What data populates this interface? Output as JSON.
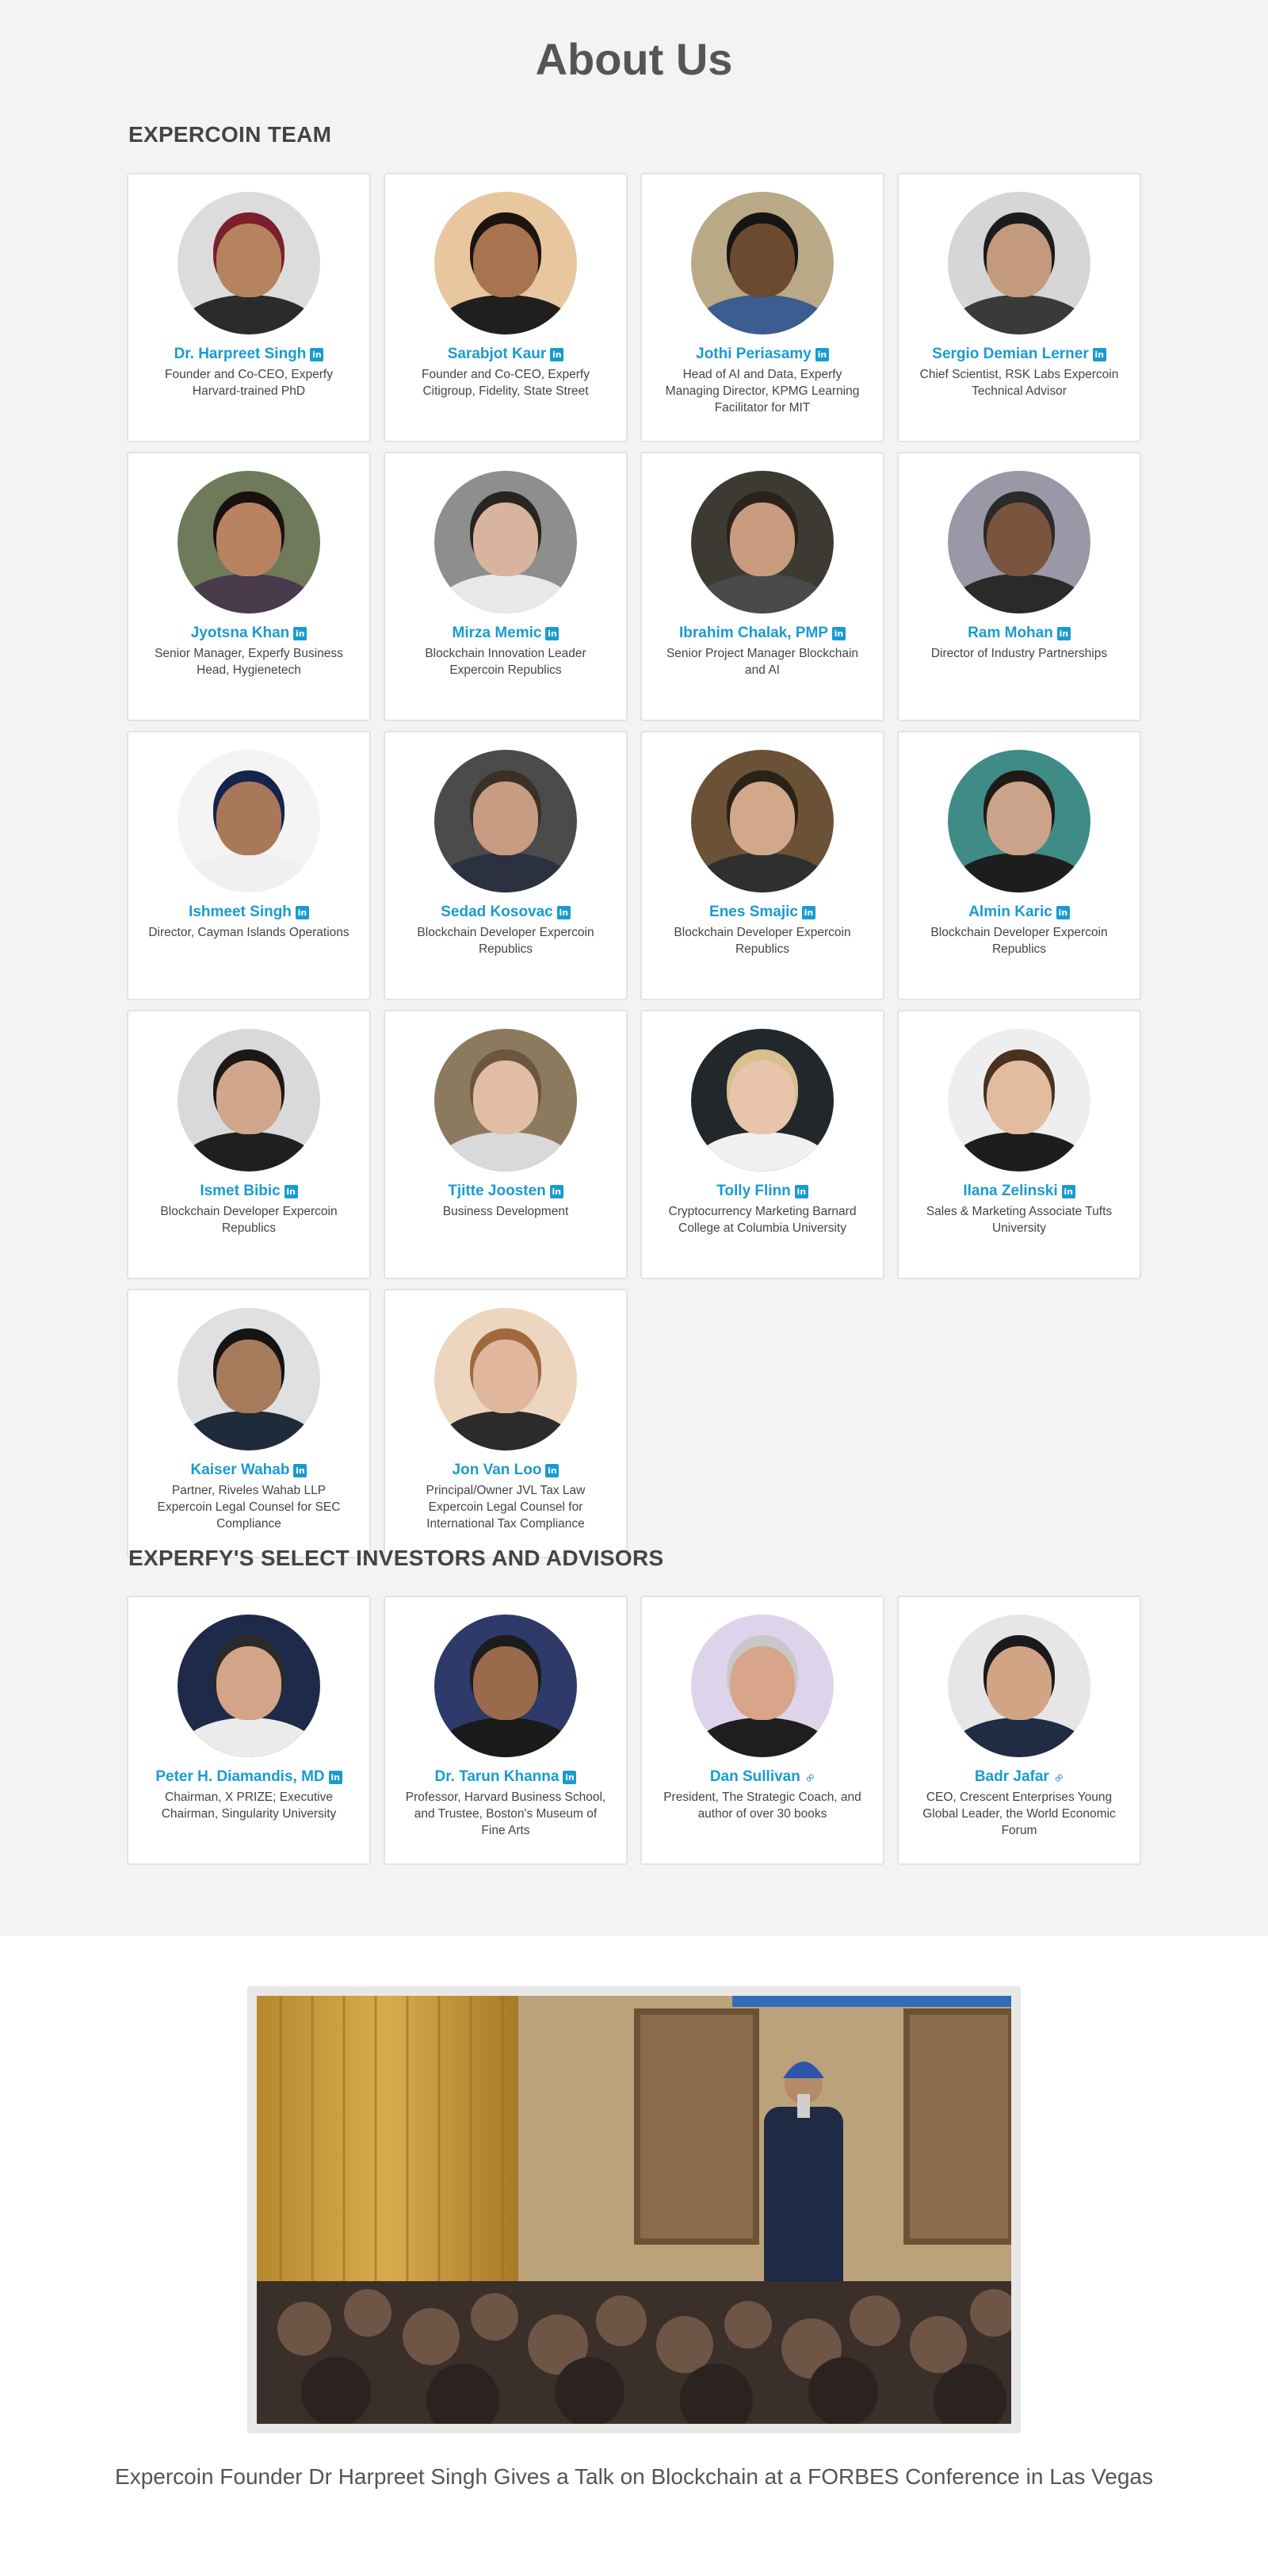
{
  "page": {
    "title": "About Us"
  },
  "team": {
    "heading": "EXPERCOIN TEAM",
    "members": [
      {
        "name": "Dr. Harpreet Singh",
        "role": "Founder and Co-CEO, Experfy Harvard-trained PhD",
        "link": "linkedin",
        "bg": "#dcdcdc",
        "skin": "#b5835e",
        "hair": "#7a1f2b",
        "shirt": "#2b2b2b"
      },
      {
        "name": "Sarabjot Kaur",
        "role": "Founder and Co-CEO, Experfy Citigroup, Fidelity, State Street",
        "link": "linkedin",
        "bg": "#e9c79e",
        "skin": "#a8744f",
        "hair": "#1d1410",
        "shirt": "#1f1f1f"
      },
      {
        "name": "Jothi Periasamy",
        "role": "Head of AI and Data, Experfy Managing Director, KPMG Learning Facilitator for MIT",
        "link": "linkedin",
        "bg": "#b9a987",
        "skin": "#6b4a30",
        "hair": "#151515",
        "shirt": "#3b5d8f"
      },
      {
        "name": "Sergio Demian Lerner",
        "role": "Chief Scientist, RSK Labs Expercoin Technical Advisor",
        "link": "linkedin",
        "bg": "#d6d6d6",
        "skin": "#c49a7e",
        "hair": "#1c1c1c",
        "shirt": "#3a3a3a"
      },
      {
        "name": "Jyotsna Khan",
        "role": "Senior Manager, Experfy Business Head, Hygienetech",
        "link": "linkedin",
        "bg": "#6f7a5a",
        "skin": "#b98361",
        "hair": "#18110d",
        "shirt": "#4a3b4c"
      },
      {
        "name": "Mirza Memic",
        "role": "Blockchain Innovation Leader Expercoin Republics",
        "link": "linkedin",
        "bg": "#8e8e8e",
        "skin": "#d8b49e",
        "hair": "#2a2420",
        "shirt": "#e8e8e8"
      },
      {
        "name": "Ibrahim Chalak, PMP",
        "role": "Senior Project Manager Blockchain and AI",
        "link": "linkedin",
        "bg": "#3d3a33",
        "skin": "#c99b7e",
        "hair": "#2c2219",
        "shirt": "#4a4a4a"
      },
      {
        "name": "Ram Mohan",
        "role": "Director of Industry Partnerships",
        "link": "linkedin",
        "bg": "#9a97a6",
        "skin": "#7a543d",
        "hair": "#2a2a2a",
        "shirt": "#2a2a2a"
      },
      {
        "name": "Ishmeet Singh",
        "role": "Director, Cayman Islands Operations",
        "link": "linkedin",
        "bg": "#f4f4f4",
        "skin": "#a9785a",
        "hair": "#15234e",
        "shirt": "#f0f0f0"
      },
      {
        "name": "Sedad Kosovac",
        "role": "Blockchain Developer Expercoin Republics",
        "link": "linkedin",
        "bg": "#4b4b4b",
        "skin": "#c79c82",
        "hair": "#3b3026",
        "shirt": "#2b3140"
      },
      {
        "name": "Enes Smajic",
        "role": "Blockchain Developer Expercoin Republics",
        "link": "linkedin",
        "bg": "#6b5236",
        "skin": "#d2a88a",
        "hair": "#2a2119",
        "shirt": "#2f2f2f"
      },
      {
        "name": "Almin Karic",
        "role": "Blockchain Developer Expercoin Republics",
        "link": "linkedin",
        "bg": "#3f8b86",
        "skin": "#cba38a",
        "hair": "#1f1a16",
        "shirt": "#1d1d1d"
      },
      {
        "name": "Ismet Bibic",
        "role": "Blockchain Developer Expercoin Republics",
        "link": "linkedin",
        "bg": "#d9d9d9",
        "skin": "#d0a78c",
        "hair": "#1d1814",
        "shirt": "#1f1f1f"
      },
      {
        "name": "Tjitte Joosten",
        "role": "Business Development",
        "link": "linkedin",
        "bg": "#8c7a5e",
        "skin": "#e1bda3",
        "hair": "#6d5640",
        "shirt": "#d9d9d9"
      },
      {
        "name": "Tolly Flinn",
        "role": "Cryptocurrency Marketing Barnard College at Columbia University",
        "link": "linkedin",
        "bg": "#22272c",
        "skin": "#e8c4ab",
        "hair": "#d8c08e",
        "shirt": "#f0f0f0"
      },
      {
        "name": "Ilana Zelinski",
        "role": "Sales & Marketing Associate Tufts University",
        "link": "linkedin",
        "bg": "#eeeeee",
        "skin": "#e3bca0",
        "hair": "#4a3220",
        "shirt": "#1d1d1d"
      },
      {
        "name": "Kaiser Wahab",
        "role": "Partner, Riveles Wahab LLP Expercoin Legal Counsel for SEC Compliance",
        "link": "linkedin",
        "bg": "#e0e0e0",
        "skin": "#a57b5c",
        "hair": "#141414",
        "shirt": "#1f2a3a"
      },
      {
        "name": "Jon Van Loo",
        "role": "Principal/Owner JVL Tax Law Expercoin Legal Counsel for International Tax Compliance",
        "link": "linkedin",
        "bg": "#ecd6c0",
        "skin": "#e0b69c",
        "hair": "#a0683d",
        "shirt": "#2b2b2b"
      }
    ]
  },
  "investors": {
    "heading": "EXPERFY'S SELECT INVESTORS AND ADVISORS",
    "members": [
      {
        "name": "Peter H. Diamandis, MD",
        "role": "Chairman, X PRIZE; Executive Chairman, Singularity University",
        "link": "linkedin",
        "bg": "#1d2a4a",
        "skin": "#d3a487",
        "hair": "#2a2a2a",
        "shirt": "#ebebeb"
      },
      {
        "name": "Dr. Tarun Khanna",
        "role": "Professor, Harvard Business School, and Trustee, Boston's Museum of Fine Arts",
        "link": "linkedin",
        "bg": "#2d3a6a",
        "skin": "#9a6a4c",
        "hair": "#1c1c1c",
        "shirt": "#1a1a1a"
      },
      {
        "name": "Dan Sullivan",
        "role": "President, The Strategic Coach, and author of over 30 books",
        "link": "web",
        "bg": "#ddd4ec",
        "skin": "#d8a58a",
        "hair": "#c8c8c8",
        "shirt": "#1e1e1e"
      },
      {
        "name": "Badr Jafar",
        "role": "CEO, Crescent Enterprises Young Global Leader, the World Economic Forum",
        "link": "web",
        "bg": "#e6e6e6",
        "skin": "#d1a486",
        "hair": "#1a1a1a",
        "shirt": "#1f2c44"
      }
    ]
  },
  "feature": {
    "caption": "Expercoin Founder Dr Harpreet Singh Gives a Talk on Blockchain at a FORBES Conference in Las Vegas"
  }
}
